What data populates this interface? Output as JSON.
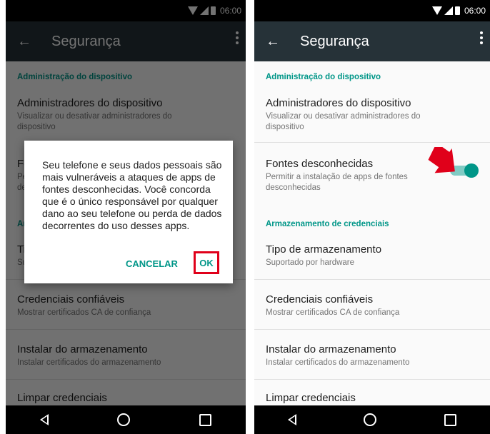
{
  "status": {
    "time": "06:00"
  },
  "appbar": {
    "title": "Segurança"
  },
  "settings": {
    "section_admin": "Administração do dispositivo",
    "admins_title": "Administradores do dispositivo",
    "admins_sub": "Visualizar ou desativar administradores do dispositivo",
    "unknown_title": "Fontes desconhecidas",
    "unknown_sub": "Permitir a instalação de apps de fontes desconhecidas",
    "unknown_enabled": true,
    "section_storage": "Armazenamento de credenciais",
    "storage_type_title": "Tipo de armazenamento",
    "storage_type_sub": "Suportado por hardware",
    "trusted_title": "Credenciais confiáveis",
    "trusted_sub": "Mostrar certificados CA de confiança",
    "install_title": "Instalar do armazenamento",
    "install_sub": "Instalar certificados do armazenamento",
    "clear_title": "Limpar credenciais"
  },
  "dialog": {
    "message": "Seu telefone e seus dados pessoais são mais vulneráveis a ataques de apps de fontes desconhecidas. Você concorda que é o único responsável por qualquer dano ao seu telefone ou perda de dados decorrentes do uso desses apps.",
    "cancel_label": "CANCELAR",
    "ok_label": "OK"
  },
  "colors": {
    "accent": "#009688",
    "highlight": "#e0001a",
    "appbar": "#263238"
  }
}
